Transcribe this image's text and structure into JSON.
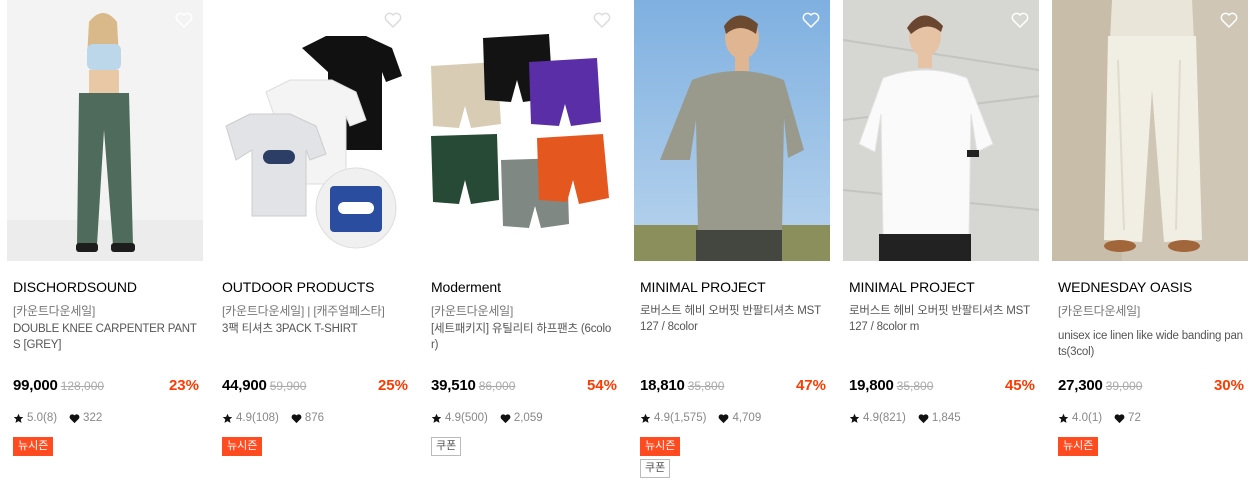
{
  "products": [
    {
      "brand": "DISCHORDSOUND",
      "promo": "[카운트다운세일]",
      "name": "DOUBLE KNEE CARPENTER PANTS [GREY]",
      "price": "99,000",
      "original_price": "128,000",
      "discount": "23%",
      "rating": "5.0(8)",
      "likes": "322",
      "badges": [
        "뉴시즌"
      ]
    },
    {
      "brand": "OUTDOOR PRODUCTS",
      "promo": "[카운트다운세일] | [캐주얼페스타]",
      "name": "3팩 티셔츠 3PACK T-SHIRT",
      "price": "44,900",
      "original_price": "59,900",
      "discount": "25%",
      "rating": "4.9(108)",
      "likes": "876",
      "badges": [
        "뉴시즌"
      ]
    },
    {
      "brand": "Moderment",
      "promo": "[카운트다운세일]",
      "name": "[세트패키지] 유틸리티 하프팬츠 (6color)",
      "price": "39,510",
      "original_price": "86,000",
      "discount": "54%",
      "rating": "4.9(500)",
      "likes": "2,059",
      "badges": [
        "쿠폰"
      ]
    },
    {
      "brand": "MINIMAL PROJECT",
      "promo": "",
      "name": "로버스트 헤비 오버핏 반팔티셔츠 MST127 / 8color",
      "price": "18,810",
      "original_price": "35,800",
      "discount": "47%",
      "rating": "4.9(1,575)",
      "likes": "4,709",
      "badges": [
        "뉴시즌",
        "쿠폰"
      ]
    },
    {
      "brand": "MINIMAL PROJECT",
      "promo": "",
      "name": "로버스트 헤비 오버핏 반팔티셔츠 MST127 / 8color m",
      "price": "19,800",
      "original_price": "35,800",
      "discount": "45%",
      "rating": "4.9(821)",
      "likes": "1,845",
      "badges": []
    },
    {
      "brand": "WEDNESDAY OASIS",
      "promo": "[카운트다운세일]",
      "name": "unisex ice linen like wide banding pants(3col)",
      "price": "27,300",
      "original_price": "39,000",
      "discount": "30%",
      "rating": "4.0(1)",
      "likes": "72",
      "badges": [
        "뉴시즌"
      ]
    }
  ],
  "icons": {
    "wishlist": "heart-outline-icon",
    "rating": "star-icon",
    "likes": "heart-filled-icon"
  },
  "colors": {
    "discount": "#ff3a00",
    "new_season_badge": "#ff4b1f",
    "coupon_border": "#bbbbbb"
  }
}
